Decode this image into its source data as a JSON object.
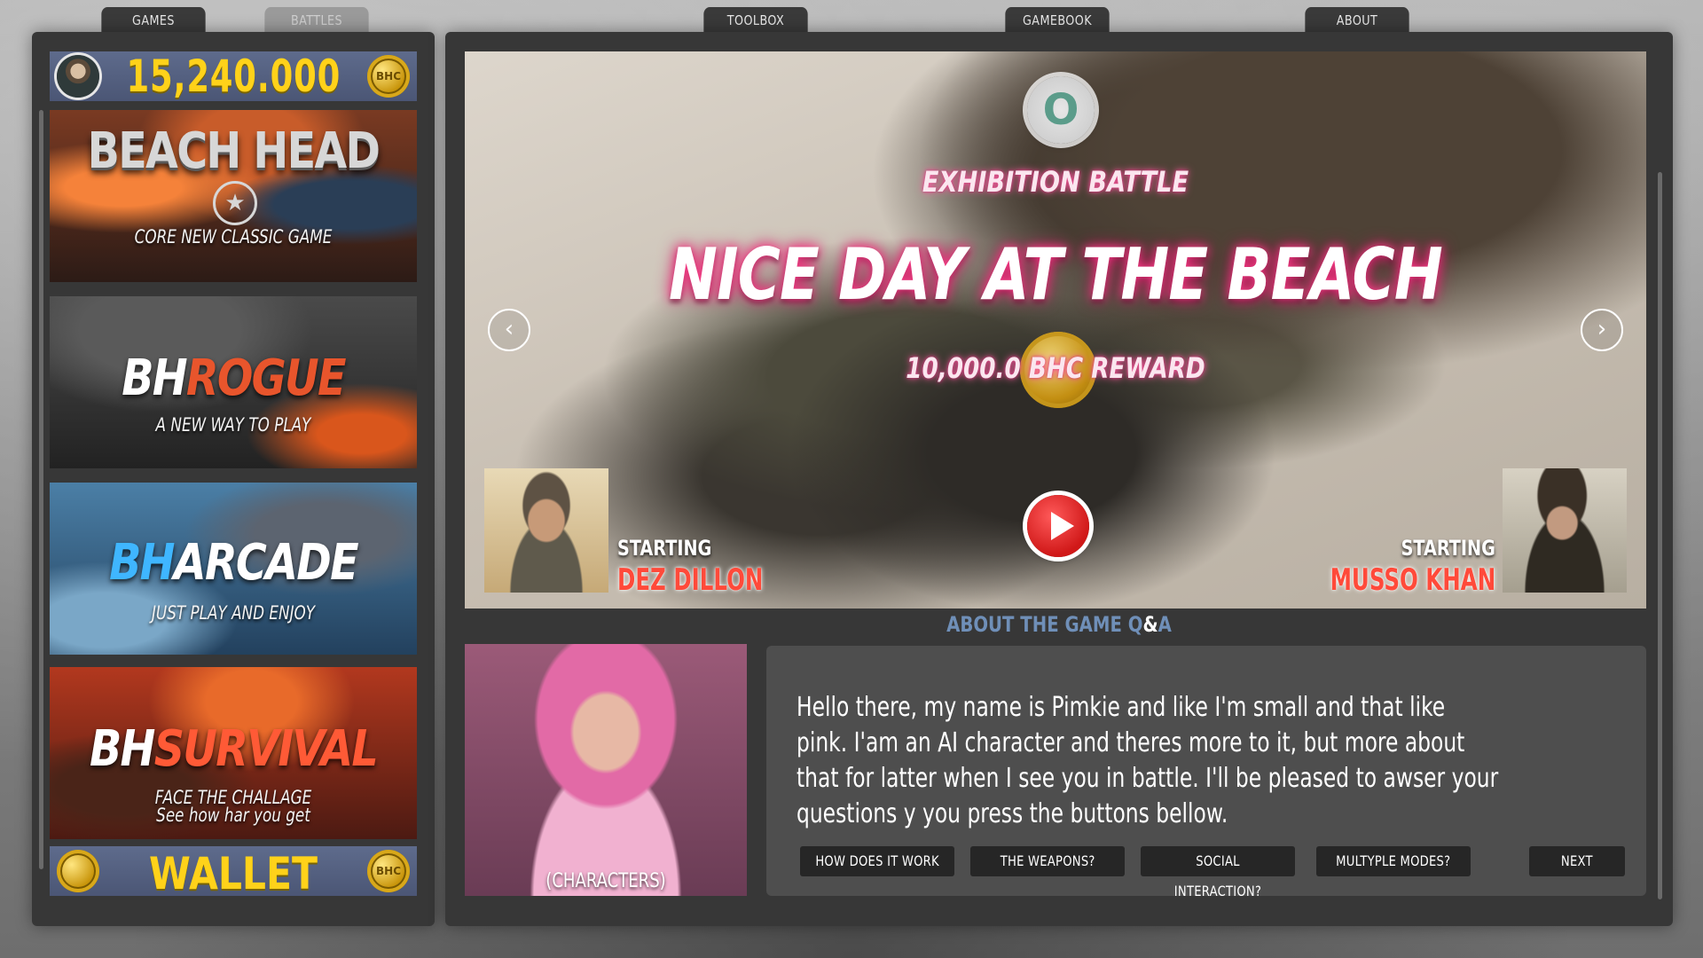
{
  "top_tabs": {
    "games": "GAMES",
    "battles": "BATTLES",
    "toolbox": "TOOLBOX",
    "gamebook": "GAMEBOOK",
    "about": "ABOUT"
  },
  "balance": {
    "value": "15,240.000",
    "coin_label": "BHC"
  },
  "games": [
    {
      "title": "BEACH HEAD",
      "subtitle": "CORE NEW CLASSIC GAME"
    },
    {
      "title_prefix": "BH",
      "title": "ROGUE",
      "subtitle": "A NEW WAY TO PLAY"
    },
    {
      "title_prefix": "BH",
      "title": "ARCADE",
      "subtitle": "JUST PLAY AND ENJOY"
    },
    {
      "title_prefix": "BH",
      "title": "SURVIVAL",
      "subtitle": "FACE THE CHALLAGE",
      "subtitle2": "See how har you get"
    }
  ],
  "wallet": {
    "label": "WALLET",
    "coin_label": "BHC"
  },
  "battle": {
    "badge": "O",
    "type": "EXHIBITION BATTLE",
    "title": "NICE DAY AT THE BEACH",
    "reward": "10,000.0 BHC REWARD",
    "prev_icon": "‹",
    "next_icon": "›",
    "left_player": {
      "label": "STARTING",
      "name": "DEZ DILLON"
    },
    "right_player": {
      "label": "STARTING",
      "name": "MUSSO KHAN"
    }
  },
  "qa": {
    "heading_a": "ABOUT THE GAME Q",
    "heading_amp": "&",
    "heading_b": "A",
    "character_label": "(CHARACTERS)",
    "message": "Hello there, my name is Pimkie and like I'm small and that like pink. I'am an AI character and theres more to it, but more about that for latter when I see you in battle. I'll be pleased to awser your questions y you press the buttons bellow.",
    "buttons": {
      "how": "HOW DOES IT WORK",
      "weapons": "THE WEAPONS?",
      "social": "SOCIAL INTERACTION?",
      "modes": "MULTYPLE MODES?",
      "next": "NEXT"
    }
  },
  "colors": {
    "gold": "#ffd21a",
    "panel": "#373737",
    "neon_pink": "#ff3d8b",
    "player_name": "#ff4a3a",
    "qa_heading": "#6f8fb8"
  }
}
